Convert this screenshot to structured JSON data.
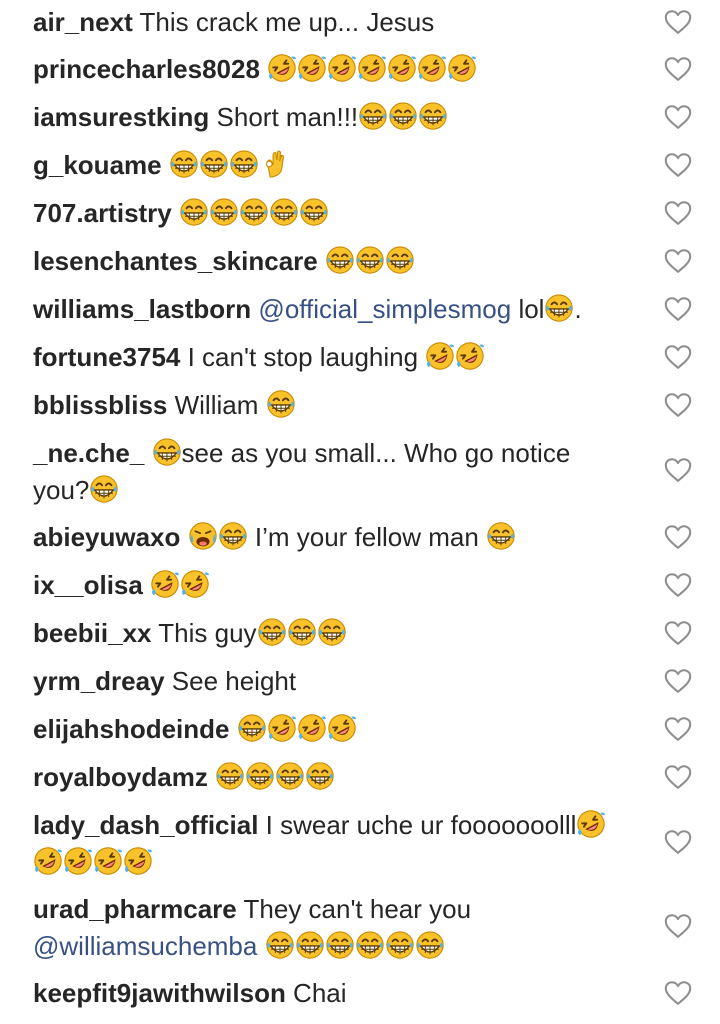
{
  "colors": {
    "username": "#262626",
    "text": "#262626",
    "mention": "#385185",
    "heart_outline": "#8e8e8e",
    "emoji_face": "#f9c22a",
    "emoji_outline": "#c98a00"
  },
  "comments": [
    {
      "user": "air_next",
      "segments": [
        {
          "t": "text",
          "v": " This crack me up... Jesus"
        }
      ]
    },
    {
      "user": "princecharles8028",
      "segments": [
        {
          "t": "text",
          "v": " "
        },
        {
          "t": "emoji",
          "name": "rofl"
        },
        {
          "t": "emoji",
          "name": "rofl"
        },
        {
          "t": "emoji",
          "name": "rofl"
        },
        {
          "t": "emoji",
          "name": "rofl"
        },
        {
          "t": "emoji",
          "name": "rofl"
        },
        {
          "t": "emoji",
          "name": "rofl"
        },
        {
          "t": "emoji",
          "name": "rofl"
        }
      ]
    },
    {
      "user": "iamsurestking",
      "segments": [
        {
          "t": "text",
          "v": " Short man!!!"
        },
        {
          "t": "emoji",
          "name": "grin-sweat"
        },
        {
          "t": "emoji",
          "name": "grin-sweat"
        },
        {
          "t": "emoji",
          "name": "grin-sweat"
        }
      ]
    },
    {
      "user": "g_kouame",
      "segments": [
        {
          "t": "text",
          "v": " "
        },
        {
          "t": "emoji",
          "name": "grin-sweat"
        },
        {
          "t": "emoji",
          "name": "grin-sweat"
        },
        {
          "t": "emoji",
          "name": "grin-sweat"
        },
        {
          "t": "emoji",
          "name": "ok-hand"
        }
      ]
    },
    {
      "user": "707.artistry",
      "segments": [
        {
          "t": "text",
          "v": " "
        },
        {
          "t": "emoji",
          "name": "grin-sweat"
        },
        {
          "t": "emoji",
          "name": "grin-sweat"
        },
        {
          "t": "emoji",
          "name": "grin-sweat"
        },
        {
          "t": "emoji",
          "name": "grin-sweat"
        },
        {
          "t": "emoji",
          "name": "grin-sweat"
        }
      ]
    },
    {
      "user": "lesenchantes_skincare",
      "segments": [
        {
          "t": "text",
          "v": " "
        },
        {
          "t": "emoji",
          "name": "grin-sweat"
        },
        {
          "t": "emoji",
          "name": "grin-sweat"
        },
        {
          "t": "emoji",
          "name": "grin-sweat"
        }
      ]
    },
    {
      "user": "williams_lastborn",
      "segments": [
        {
          "t": "text",
          "v": " "
        },
        {
          "t": "mention",
          "v": "@official_simplesmog"
        },
        {
          "t": "text",
          "v": " lol"
        },
        {
          "t": "emoji",
          "name": "grin-sweat"
        },
        {
          "t": "text",
          "v": "."
        }
      ]
    },
    {
      "user": "fortune3754",
      "segments": [
        {
          "t": "text",
          "v": " I can't stop laughing "
        },
        {
          "t": "emoji",
          "name": "rofl"
        },
        {
          "t": "emoji",
          "name": "rofl"
        }
      ]
    },
    {
      "user": "bblissbliss",
      "segments": [
        {
          "t": "text",
          "v": " William "
        },
        {
          "t": "emoji",
          "name": "grin-sweat"
        }
      ]
    },
    {
      "user": "_ne.che_",
      "segments": [
        {
          "t": "text",
          "v": " "
        },
        {
          "t": "emoji",
          "name": "grin-sweat"
        },
        {
          "t": "text",
          "v": "see as you small... Who go notice you?"
        },
        {
          "t": "emoji",
          "name": "grin-sweat"
        }
      ]
    },
    {
      "user": "abieyuwaxo",
      "segments": [
        {
          "t": "text",
          "v": " "
        },
        {
          "t": "emoji",
          "name": "weary-cry"
        },
        {
          "t": "emoji",
          "name": "grin-sweat"
        },
        {
          "t": "text",
          "v": " I’m your fellow man "
        },
        {
          "t": "emoji",
          "name": "grin-sweat"
        }
      ]
    },
    {
      "user": "ix__olisa",
      "segments": [
        {
          "t": "text",
          "v": " "
        },
        {
          "t": "emoji",
          "name": "rofl"
        },
        {
          "t": "emoji",
          "name": "rofl"
        }
      ]
    },
    {
      "user": "beebii_xx",
      "segments": [
        {
          "t": "text",
          "v": " This guy"
        },
        {
          "t": "emoji",
          "name": "grin-sweat"
        },
        {
          "t": "emoji",
          "name": "grin-sweat"
        },
        {
          "t": "emoji",
          "name": "grin-sweat"
        }
      ]
    },
    {
      "user": "yrm_dreay",
      "segments": [
        {
          "t": "text",
          "v": " See height"
        }
      ]
    },
    {
      "user": "elijahshodeinde",
      "segments": [
        {
          "t": "text",
          "v": " "
        },
        {
          "t": "emoji",
          "name": "grin-sweat"
        },
        {
          "t": "emoji",
          "name": "rofl"
        },
        {
          "t": "emoji",
          "name": "rofl"
        },
        {
          "t": "emoji",
          "name": "rofl"
        }
      ]
    },
    {
      "user": "royalboydamz",
      "segments": [
        {
          "t": "text",
          "v": " "
        },
        {
          "t": "emoji",
          "name": "grin-sweat"
        },
        {
          "t": "emoji",
          "name": "grin-sweat"
        },
        {
          "t": "emoji",
          "name": "grin-sweat"
        },
        {
          "t": "emoji",
          "name": "grin-sweat"
        }
      ]
    },
    {
      "user": "lady_dash_official",
      "segments": [
        {
          "t": "text",
          "v": " I swear uche ur fooooooolll"
        },
        {
          "t": "emoji",
          "name": "rofl"
        },
        {
          "t": "emoji",
          "name": "rofl"
        },
        {
          "t": "emoji",
          "name": "rofl"
        },
        {
          "t": "emoji",
          "name": "rofl"
        },
        {
          "t": "emoji",
          "name": "rofl"
        }
      ]
    },
    {
      "user": "urad_pharmcare",
      "segments": [
        {
          "t": "text",
          "v": " They can't hear you "
        },
        {
          "t": "mention",
          "v": "@williamsuchemba"
        },
        {
          "t": "text",
          "v": " "
        },
        {
          "t": "emoji",
          "name": "grin-sweat"
        },
        {
          "t": "emoji",
          "name": "grin-sweat"
        },
        {
          "t": "emoji",
          "name": "grin-sweat"
        },
        {
          "t": "emoji",
          "name": "grin-sweat"
        },
        {
          "t": "emoji",
          "name": "grin-sweat"
        },
        {
          "t": "emoji",
          "name": "grin-sweat"
        }
      ]
    },
    {
      "user": "keepfit9jawithwilson",
      "segments": [
        {
          "t": "text",
          "v": " Chai"
        }
      ]
    }
  ]
}
